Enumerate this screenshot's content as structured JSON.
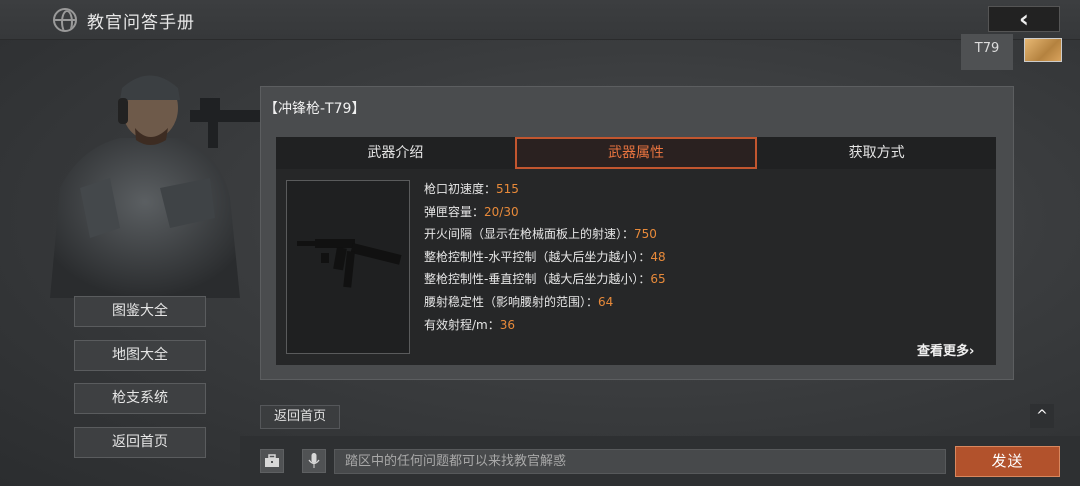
{
  "header": {
    "title": "教官问答手册",
    "back_icon": "‹"
  },
  "user": {
    "tag": "T79",
    "avatar_icon": "cat-avatar"
  },
  "nav": {
    "items": [
      "图鉴大全",
      "地图大全",
      "枪支系统",
      "返回首页"
    ]
  },
  "card": {
    "title": "【冲锋枪-T79】",
    "tabs": [
      "武器介绍",
      "武器属性",
      "获取方式"
    ],
    "active_tab": "武器属性",
    "stats": [
      {
        "label": "枪口初速度：",
        "value": "515"
      },
      {
        "label": "弹匣容量：",
        "value": "20/30"
      },
      {
        "label": "开火间隔（显示在枪械面板上的射速）：",
        "value": "750"
      },
      {
        "label": "整枪控制性-水平控制（越大后坐力越小）：",
        "value": "48"
      },
      {
        "label": "整枪控制性-垂直控制（越大后坐力越小）：",
        "value": "65"
      },
      {
        "label": "腰射稳定性（影响腰射的范围）：",
        "value": "64"
      },
      {
        "label": "有效射程/m：",
        "value": "36"
      }
    ],
    "more_label": "查看更多",
    "more_icon": "›"
  },
  "chat": {
    "home_link": "返回首页",
    "scroll_icon": "^",
    "placeholder": "踏区中的任何问题都可以来找教官解惑",
    "send_label": "发送"
  },
  "colors": {
    "accent": "#e8743f",
    "value": "#e88a3a",
    "send": "#b2522c"
  }
}
